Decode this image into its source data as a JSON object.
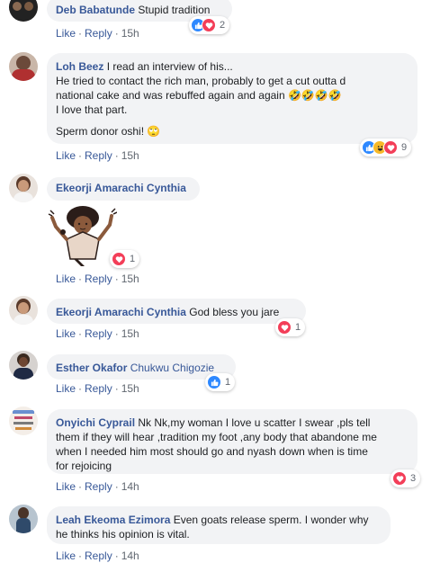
{
  "comments": [
    {
      "author": "Deb Babatunde",
      "tag": "",
      "text": "Stupid tradition",
      "reactions": "2",
      "time": "15h"
    },
    {
      "author": "Loh Beez",
      "tag": "",
      "text": "I read an interview of his...",
      "lines": [
        "He tried to contact the rich man, probably to get a cut outta d",
        "national cake and was rebuffed again and again 🤣🤣🤣🤣",
        "I love that part.",
        "",
        "Sperm donor oshi! 🙄"
      ],
      "reactions": "9",
      "time": "15h"
    },
    {
      "author": "Ekeorji Amarachi Cynthia",
      "tag": "",
      "text": "",
      "reactions": "1",
      "time": "15h"
    },
    {
      "author": "Ekeorji Amarachi Cynthia",
      "tag": "",
      "text": "God bless you jare",
      "reactions": "1",
      "time": "15h"
    },
    {
      "author": "Esther Okafor",
      "tag": "Chukwu Chigozie",
      "text": "",
      "reactions": "1",
      "time": "15h"
    },
    {
      "author": "Onyichi Cyprail",
      "tag": "",
      "text": "Nk Nk,my woman I love u scatter I swear ,pls tell",
      "lines": [
        "them if they will hear ,tradition my foot ,any body that abandone me",
        "when I needed him most should go and nyash down when is time",
        "for rejoicing"
      ],
      "reactions": "3",
      "time": "14h"
    },
    {
      "author": "Leah Ekeoma Ezimora",
      "tag": "",
      "text": "Even goats release sperm. I wonder why",
      "lines": [
        "he thinks his opinion is vital."
      ],
      "reactions": "",
      "time": "14h"
    }
  ],
  "actions": {
    "like": "Like",
    "reply": "Reply",
    "sep": "·"
  },
  "colors": {
    "link": "#385898",
    "bubble": "#f2f3f5",
    "like": "#2d88ff",
    "love": "#f33e58",
    "haha": "#f7b928"
  },
  "icons": [
    "like-reaction-icon",
    "love-reaction-icon",
    "haha-reaction-icon",
    "sticker-image"
  ]
}
